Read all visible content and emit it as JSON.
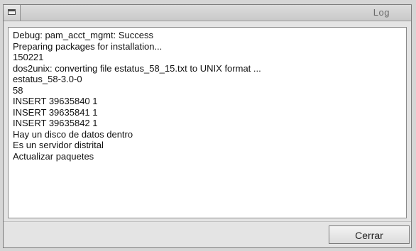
{
  "window": {
    "title": "Log"
  },
  "log": {
    "lines": [
      "Debug: pam_acct_mgmt: Success",
      "Preparing packages for installation...",
      "150221",
      "dos2unix: converting file estatus_58_15.txt to UNIX format ...",
      "estatus_58-3.0-0",
      "58",
      "INSERT 39635840 1",
      "INSERT 39635841 1",
      "INSERT 39635842 1",
      "Hay un disco de datos dentro",
      "Es un servidor distrital",
      "Actualizar paquetes"
    ]
  },
  "footer": {
    "close_label": "Cerrar"
  }
}
